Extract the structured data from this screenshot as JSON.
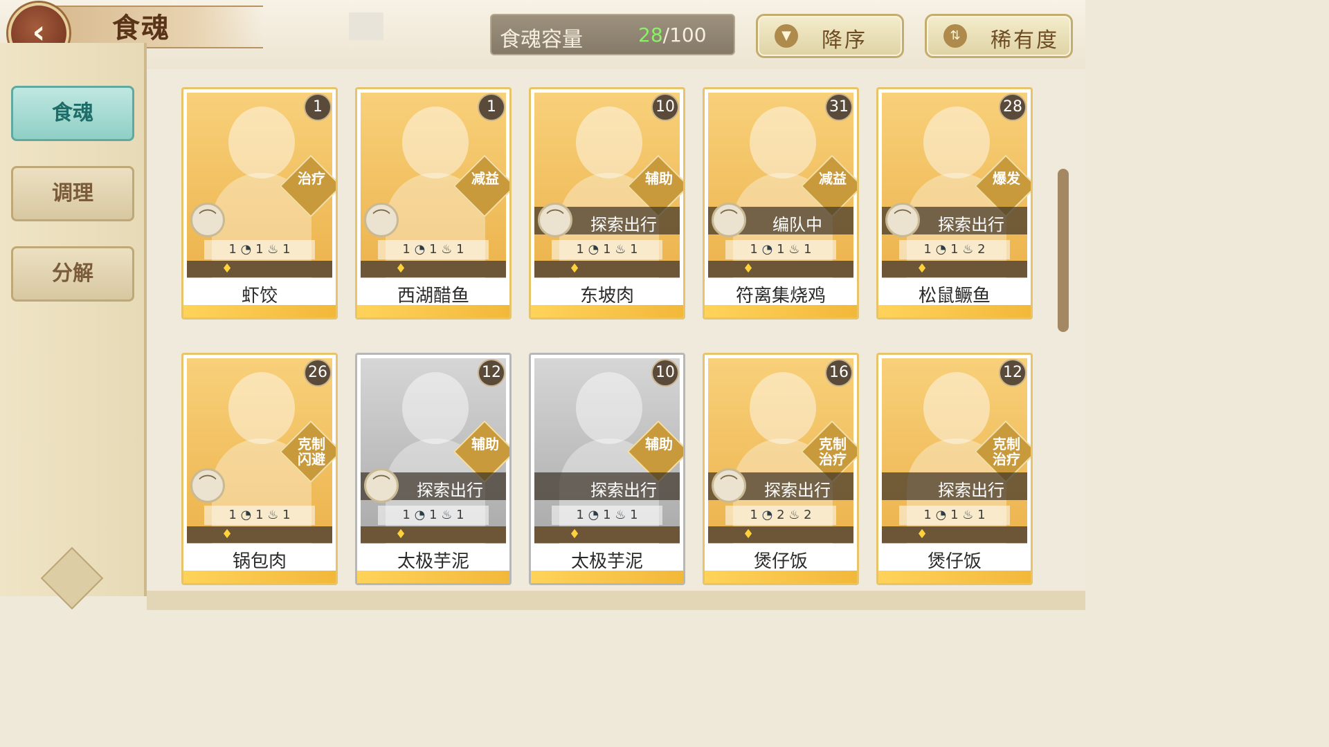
{
  "header": {
    "back_icon": "chevron-left-icon",
    "title": "食魂",
    "capacity_label": "食魂容量",
    "capacity_current": "28",
    "capacity_total": "/100",
    "sort_order_label": "降序",
    "sort_order_icon": "triangle-down-icon",
    "sort_rarity_label": "稀有度",
    "sort_rarity_icon": "sort-arrows-icon"
  },
  "sidebar": {
    "items": [
      {
        "label": "食魂"
      },
      {
        "label": "调理"
      },
      {
        "label": "分解"
      }
    ]
  },
  "cards": [
    {
      "name": "虾饺",
      "level": "1",
      "role": "治疗",
      "status": "",
      "stats": [
        "1",
        "1",
        "1"
      ],
      "grey": false
    },
    {
      "name": "西湖醋鱼",
      "level": "1",
      "role": "减益",
      "status": "",
      "stats": [
        "1",
        "1",
        "1"
      ],
      "grey": false
    },
    {
      "name": "东坡肉",
      "level": "10",
      "role": "辅助",
      "status": "探索出行",
      "stats": [
        "1",
        "1",
        "1"
      ],
      "grey": false
    },
    {
      "name": "符离集烧鸡",
      "level": "31",
      "role": "减益",
      "status": "编队中",
      "stats": [
        "1",
        "1",
        "1"
      ],
      "grey": false
    },
    {
      "name": "松鼠鳜鱼",
      "level": "28",
      "role": "爆发",
      "status": "探索出行",
      "stats": [
        "1",
        "1",
        "2"
      ],
      "grey": false
    },
    {
      "name": "锅包肉",
      "level": "26",
      "role": "克制\n闪避",
      "status": "",
      "stats": [
        "1",
        "1",
        "1"
      ],
      "grey": false
    },
    {
      "name": "太极芋泥",
      "level": "12",
      "role": "辅助",
      "status": "探索出行",
      "stats": [
        "1",
        "1",
        "1"
      ],
      "grey": true
    },
    {
      "name": "太极芋泥",
      "level": "10",
      "role": "辅助",
      "status": "探索出行",
      "stats": [
        "1",
        "1",
        "1"
      ],
      "grey": true
    },
    {
      "name": "煲仔饭",
      "level": "16",
      "role": "克制\n治疗",
      "status": "探索出行",
      "stats": [
        "1",
        "2",
        "2"
      ],
      "grey": false
    },
    {
      "name": "煲仔饭",
      "level": "12",
      "role": "克制\n治疗",
      "status": "探索出行",
      "stats": [
        "1",
        "1",
        "1"
      ],
      "grey": false
    }
  ],
  "colors": {
    "accent_gold": "#e7c36a",
    "capacity_current": "#8df06a",
    "active_tab": "#8fcfc6"
  }
}
